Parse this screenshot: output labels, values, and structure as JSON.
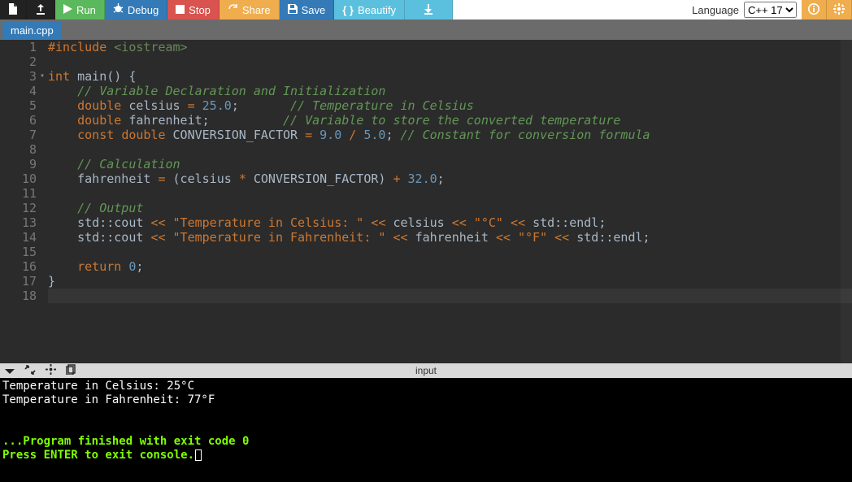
{
  "toolbar": {
    "run": "Run",
    "debug": "Debug",
    "stop": "Stop",
    "share": "Share",
    "save": "Save",
    "beautify": "Beautify",
    "language_label": "Language",
    "language_selected": "C++ 17",
    "language_options": [
      "C++ 17"
    ]
  },
  "tabs": [
    {
      "label": "main.cpp"
    }
  ],
  "editor": {
    "active_line": 18,
    "lines": [
      {
        "n": 1,
        "tokens": [
          [
            "pre",
            "#include"
          ],
          [
            "sp",
            " "
          ],
          [
            "inc",
            "<iostream>"
          ]
        ]
      },
      {
        "n": 2,
        "tokens": []
      },
      {
        "n": 3,
        "fold": true,
        "tokens": [
          [
            "kw",
            "int"
          ],
          [
            "sp",
            " "
          ],
          [
            "id",
            "main() {"
          ]
        ]
      },
      {
        "n": 4,
        "tokens": [
          [
            "sp",
            "    "
          ],
          [
            "cmt",
            "// Variable Declaration and Initialization"
          ]
        ]
      },
      {
        "n": 5,
        "tokens": [
          [
            "sp",
            "    "
          ],
          [
            "kw",
            "double"
          ],
          [
            "sp",
            " "
          ],
          [
            "id",
            "celsius "
          ],
          [
            "op",
            "="
          ],
          [
            "sp",
            " "
          ],
          [
            "num",
            "25.0"
          ],
          [
            "id",
            ";       "
          ],
          [
            "cmt",
            "// Temperature in Celsius"
          ]
        ]
      },
      {
        "n": 6,
        "tokens": [
          [
            "sp",
            "    "
          ],
          [
            "kw",
            "double"
          ],
          [
            "sp",
            " "
          ],
          [
            "id",
            "fahrenheit;          "
          ],
          [
            "cmt",
            "// Variable to store the converted temperature"
          ]
        ]
      },
      {
        "n": 7,
        "tokens": [
          [
            "sp",
            "    "
          ],
          [
            "kw",
            "const"
          ],
          [
            "sp",
            " "
          ],
          [
            "kw",
            "double"
          ],
          [
            "sp",
            " "
          ],
          [
            "id",
            "CONVERSION_FACTOR "
          ],
          [
            "op",
            "="
          ],
          [
            "sp",
            " "
          ],
          [
            "num",
            "9.0"
          ],
          [
            "sp",
            " "
          ],
          [
            "op",
            "/"
          ],
          [
            "sp",
            " "
          ],
          [
            "num",
            "5.0"
          ],
          [
            "id",
            "; "
          ],
          [
            "cmt",
            "// Constant for conversion formula"
          ]
        ]
      },
      {
        "n": 8,
        "tokens": []
      },
      {
        "n": 9,
        "tokens": [
          [
            "sp",
            "    "
          ],
          [
            "cmt",
            "// Calculation"
          ]
        ]
      },
      {
        "n": 10,
        "tokens": [
          [
            "sp",
            "    "
          ],
          [
            "id",
            "fahrenheit "
          ],
          [
            "op",
            "="
          ],
          [
            "sp",
            " "
          ],
          [
            "id",
            "(celsius "
          ],
          [
            "op",
            "*"
          ],
          [
            "sp",
            " "
          ],
          [
            "id",
            "CONVERSION_FACTOR) "
          ],
          [
            "op",
            "+"
          ],
          [
            "sp",
            " "
          ],
          [
            "num",
            "32.0"
          ],
          [
            "id",
            ";"
          ]
        ]
      },
      {
        "n": 11,
        "tokens": []
      },
      {
        "n": 12,
        "tokens": [
          [
            "sp",
            "    "
          ],
          [
            "cmt",
            "// Output"
          ]
        ]
      },
      {
        "n": 13,
        "tokens": [
          [
            "sp",
            "    "
          ],
          [
            "id",
            "std::cout "
          ],
          [
            "op",
            "<<"
          ],
          [
            "sp",
            " "
          ],
          [
            "str",
            "\"Temperature in Celsius: \""
          ],
          [
            "sp",
            " "
          ],
          [
            "op",
            "<<"
          ],
          [
            "sp",
            " "
          ],
          [
            "id",
            "celsius "
          ],
          [
            "op",
            "<<"
          ],
          [
            "sp",
            " "
          ],
          [
            "str",
            "\"°C\""
          ],
          [
            "sp",
            " "
          ],
          [
            "op",
            "<<"
          ],
          [
            "sp",
            " "
          ],
          [
            "id",
            "std::endl;"
          ]
        ]
      },
      {
        "n": 14,
        "tokens": [
          [
            "sp",
            "    "
          ],
          [
            "id",
            "std::cout "
          ],
          [
            "op",
            "<<"
          ],
          [
            "sp",
            " "
          ],
          [
            "str",
            "\"Temperature in Fahrenheit: \""
          ],
          [
            "sp",
            " "
          ],
          [
            "op",
            "<<"
          ],
          [
            "sp",
            " "
          ],
          [
            "id",
            "fahrenheit "
          ],
          [
            "op",
            "<<"
          ],
          [
            "sp",
            " "
          ],
          [
            "str",
            "\"°F\""
          ],
          [
            "sp",
            " "
          ],
          [
            "op",
            "<<"
          ],
          [
            "sp",
            " "
          ],
          [
            "id",
            "std::endl;"
          ]
        ]
      },
      {
        "n": 15,
        "tokens": []
      },
      {
        "n": 16,
        "tokens": [
          [
            "sp",
            "    "
          ],
          [
            "kw",
            "return"
          ],
          [
            "sp",
            " "
          ],
          [
            "num",
            "0"
          ],
          [
            "id",
            ";"
          ]
        ]
      },
      {
        "n": 17,
        "tokens": [
          [
            "id",
            "}"
          ]
        ]
      },
      {
        "n": 18,
        "tokens": []
      }
    ]
  },
  "console_toolbar": {
    "input_label": "input"
  },
  "console": {
    "lines": [
      {
        "text": "Temperature in Celsius: 25°C",
        "cls": ""
      },
      {
        "text": "Temperature in Fahrenheit: 77°F",
        "cls": ""
      },
      {
        "text": "",
        "cls": ""
      },
      {
        "text": "",
        "cls": ""
      },
      {
        "text": "...Program finished with exit code 0",
        "cls": "c-green"
      },
      {
        "text": "Press ENTER to exit console.",
        "cls": "c-green",
        "cursor": true
      }
    ]
  }
}
